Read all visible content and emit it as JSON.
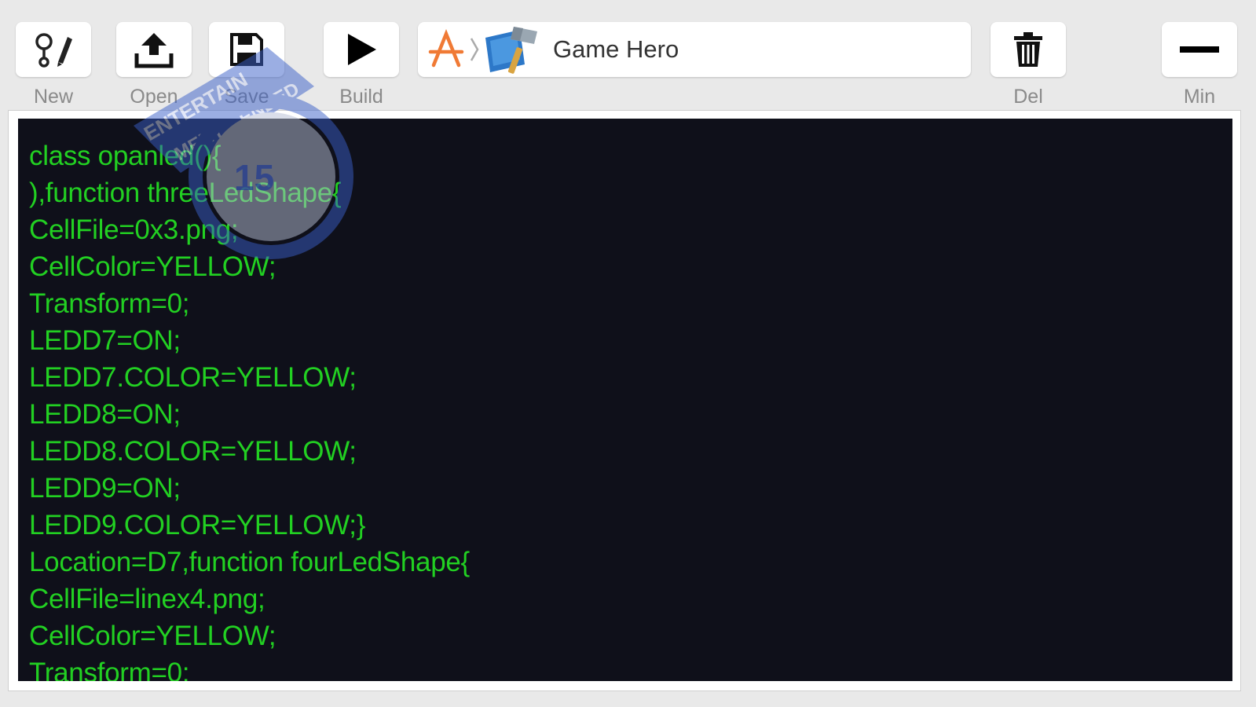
{
  "toolbar": {
    "new_label": "New",
    "open_label": "Open",
    "save_label": "Save",
    "build_label": "Build",
    "delete_label": "Del",
    "minimize_label": "Min"
  },
  "scheme": {
    "name": "Game Hero"
  },
  "watermark": {
    "line1": "ENTERTAIN",
    "line2": "MENT",
    "line3": "ENDED",
    "number": "15"
  },
  "editor": {
    "lines": [
      "class opanled(){",
      "),function threeLedShape{",
      "CellFile=0x3.png;",
      "CellColor=YELLOW;",
      "Transform=0;",
      "LEDD7=ON;",
      "LEDD7.COLOR=YELLOW;",
      "LEDD8=ON;",
      "LEDD8.COLOR=YELLOW;",
      "LEDD9=ON;",
      "LEDD9.COLOR=YELLOW;}",
      "Location=D7,function fourLedShape{",
      "CellFile=linex4.png;",
      "CellColor=YELLOW;",
      "Transform=0;"
    ]
  },
  "colors": {
    "code_text": "#22d022",
    "editor_bg": "#0f101a",
    "toolbar_bg": "#e9e9e9",
    "stamp_blue": "#3a5fc8"
  }
}
